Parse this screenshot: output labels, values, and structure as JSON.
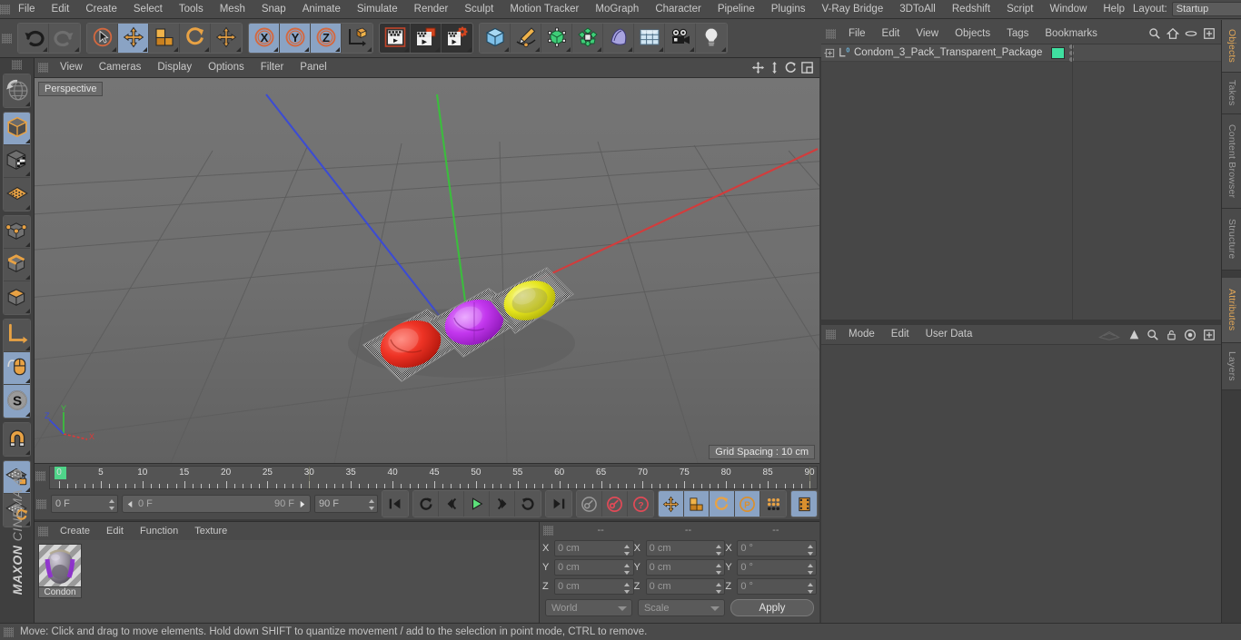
{
  "app": {
    "title": "MAXON CINEMA 4D",
    "brand_top": "MAXON",
    "brand_bottom": "CINEMA 4D"
  },
  "menubar": {
    "items": [
      "File",
      "Edit",
      "Create",
      "Select",
      "Tools",
      "Mesh",
      "Snap",
      "Animate",
      "Simulate",
      "Render",
      "Sculpt",
      "Motion Tracker",
      "MoGraph",
      "Character",
      "Pipeline",
      "Plugins",
      "V-Ray Bridge",
      "3DToAll",
      "Redshift",
      "Script",
      "Window",
      "Help"
    ],
    "layout_label": "Layout:",
    "layout_value": "Startup"
  },
  "toolbar": {
    "groups": [
      {
        "name": "history",
        "buttons": [
          {
            "name": "undo-button",
            "icon": "undo-icon",
            "state": "normal"
          },
          {
            "name": "redo-button",
            "icon": "redo-icon",
            "state": "disabled"
          }
        ]
      },
      {
        "name": "transform-tools",
        "buttons": [
          {
            "name": "live-selection-button",
            "icon": "live-selection-icon",
            "state": "normal"
          },
          {
            "name": "move-tool-button",
            "icon": "move-icon",
            "state": "active"
          },
          {
            "name": "scale-tool-button",
            "icon": "scale-icon",
            "state": "normal"
          },
          {
            "name": "rotate-tool-button",
            "icon": "rotate-icon",
            "state": "normal"
          },
          {
            "name": "move-duplicate-button",
            "icon": "move-icon",
            "state": "normal"
          }
        ]
      },
      {
        "name": "axis-locks",
        "buttons": [
          {
            "name": "lock-x-button",
            "icon": "x-axis-icon",
            "state": "active"
          },
          {
            "name": "lock-y-button",
            "icon": "y-axis-icon",
            "state": "active"
          },
          {
            "name": "lock-z-button",
            "icon": "z-axis-icon",
            "state": "active"
          },
          {
            "name": "world-object-axis-button",
            "icon": "world-axis-icon",
            "state": "normal"
          }
        ]
      },
      {
        "name": "render-tools",
        "buttons": [
          {
            "name": "render-view-button",
            "icon": "render-view-icon",
            "state": "dark"
          },
          {
            "name": "render-to-picture-viewer-button",
            "icon": "render-picture-icon",
            "state": "dark"
          },
          {
            "name": "render-settings-button",
            "icon": "render-settings-icon",
            "state": "dark"
          }
        ]
      },
      {
        "name": "create-objects",
        "buttons": [
          {
            "name": "add-primitive-button",
            "icon": "cube-icon",
            "state": "normal"
          },
          {
            "name": "add-spline-button",
            "icon": "pen-spline-icon",
            "state": "normal"
          },
          {
            "name": "add-generator-button",
            "icon": "generator-icon",
            "state": "normal"
          },
          {
            "name": "add-deformer-button",
            "icon": "deformer-icon",
            "state": "normal"
          },
          {
            "name": "add-scene-object-button",
            "icon": "scene-object-icon",
            "state": "normal"
          },
          {
            "name": "add-environment-button",
            "icon": "environment-icon",
            "state": "normal"
          },
          {
            "name": "add-camera-button",
            "icon": "camera-icon",
            "state": "normal"
          },
          {
            "name": "add-light-button",
            "icon": "light-bulb-icon",
            "state": "normal"
          }
        ]
      }
    ]
  },
  "left_toolbar": {
    "groups": [
      {
        "buttons": [
          {
            "name": "undo-view-button",
            "icon": "globe-undo-icon",
            "state": "normal"
          }
        ]
      },
      {
        "buttons": [
          {
            "name": "model-mode-button",
            "icon": "model-cube-icon",
            "state": "active"
          },
          {
            "name": "texture-mode-button",
            "icon": "texture-cube-icon",
            "state": "normal"
          },
          {
            "name": "workplane-mode-button",
            "icon": "workplane-icon",
            "state": "normal"
          }
        ]
      },
      {
        "buttons": [
          {
            "name": "point-mode-button",
            "icon": "point-cube-icon",
            "state": "normal"
          },
          {
            "name": "edge-mode-button",
            "icon": "edge-cube-icon",
            "state": "normal"
          },
          {
            "name": "polygon-mode-button",
            "icon": "polygon-cube-icon",
            "state": "normal"
          }
        ]
      },
      {
        "buttons": [
          {
            "name": "object-axis-button",
            "icon": "axis-icon",
            "state": "normal"
          },
          {
            "name": "viewport-solo-button",
            "icon": "mouse-icon",
            "state": "active"
          },
          {
            "name": "soft-selection-button",
            "icon": "soft-selection-icon",
            "state": "active"
          }
        ]
      },
      {
        "buttons": [
          {
            "name": "magnet-tool-button",
            "icon": "magnet-icon",
            "state": "normal"
          }
        ]
      },
      {
        "buttons": [
          {
            "name": "lock-workplane-button",
            "icon": "workplane-lock-icon",
            "state": "active"
          },
          {
            "name": "workplane-rotate-button",
            "icon": "workplane-rotate-icon",
            "state": "normal"
          }
        ]
      }
    ]
  },
  "viewport": {
    "menu": [
      "View",
      "Cameras",
      "Display",
      "Options",
      "Filter",
      "Panel"
    ],
    "camera_label": "Perspective",
    "grid_spacing": "Grid Spacing : 10 cm",
    "header_icons": [
      "move-camera-icon",
      "dolly-camera-icon",
      "rotate-camera-icon",
      "maximize-viewport-icon"
    ],
    "axis_gizmo": {
      "x": "X",
      "y": "Y",
      "z": "Z"
    },
    "scene": {
      "objects": [
        {
          "name": "condom-package-red",
          "color": "#e02a1e"
        },
        {
          "name": "condom-package-magenta",
          "color": "#c234e8"
        },
        {
          "name": "condom-package-yellow",
          "color": "#e2e21a"
        }
      ],
      "axis_colors": {
        "x": "#d83a3a",
        "y": "#39c23b",
        "z": "#3a4ad8"
      }
    }
  },
  "timeline": {
    "tick_labels": [
      "0",
      "5",
      "10",
      "15",
      "20",
      "25",
      "30",
      "35",
      "40",
      "45",
      "50",
      "55",
      "60",
      "65",
      "70",
      "75",
      "80",
      "85",
      "90"
    ],
    "current_frame": "0 F",
    "preview_min": "0 F",
    "preview_max": "90 F",
    "end_frame": "90 F",
    "frame_field_right": "0 F",
    "transport": [
      {
        "name": "go-to-start-button",
        "icon": "skip-start-icon",
        "state": "normal"
      },
      {
        "name": "play-backwards-loop-button",
        "icon": "loop-icon",
        "state": "normal"
      },
      {
        "name": "step-back-button",
        "icon": "step-back-icon",
        "state": "normal"
      },
      {
        "name": "play-button",
        "icon": "play-icon",
        "state": "normal"
      },
      {
        "name": "step-forward-button",
        "icon": "step-forward-icon",
        "state": "normal"
      },
      {
        "name": "loop-playback-button",
        "icon": "loop-forward-icon",
        "state": "normal"
      },
      {
        "name": "go-to-end-button",
        "icon": "skip-end-icon",
        "state": "normal"
      }
    ],
    "keyframe_tools": [
      {
        "name": "record-active-objects-button",
        "icon": "key-icon",
        "state": "normal"
      },
      {
        "name": "autokeying-button",
        "icon": "autokey-icon",
        "state": "normal"
      },
      {
        "name": "keyframe-selection-button",
        "icon": "keyframe-question-icon",
        "state": "normal"
      }
    ],
    "position_tools": [
      {
        "name": "record-position-button",
        "icon": "move-icon",
        "state": "active"
      },
      {
        "name": "record-scale-button",
        "icon": "scale-icon",
        "state": "active"
      },
      {
        "name": "record-rotation-button",
        "icon": "rotate-icon",
        "state": "active"
      },
      {
        "name": "record-parameter-button",
        "icon": "parameter-p-icon",
        "state": "active"
      },
      {
        "name": "point-level-animation-button",
        "icon": "pla-dots-icon",
        "state": "normal"
      },
      {
        "name": "timeline-toggle-button",
        "icon": "film-strip-icon",
        "state": "active"
      }
    ]
  },
  "material_manager": {
    "menu": [
      "Create",
      "Edit",
      "Function",
      "Texture"
    ],
    "materials": [
      {
        "name": "Condon",
        "swatch_color": "#a98fbe"
      }
    ]
  },
  "coordinates": {
    "header_cols": [
      "--",
      "--",
      "--"
    ],
    "rows": [
      {
        "axis": "X",
        "position": "0 cm",
        "size": "0 cm",
        "rotation": "0 °"
      },
      {
        "axis": "Y",
        "position": "0 cm",
        "size": "0 cm",
        "rotation": "0 °"
      },
      {
        "axis": "Z",
        "position": "0 cm",
        "size": "0 cm",
        "rotation": "0 °"
      }
    ],
    "coord_system": "World",
    "transform_mode": "Scale",
    "apply_label": "Apply"
  },
  "object_manager": {
    "menu": [
      "File",
      "Edit",
      "View",
      "Objects",
      "Tags",
      "Bookmarks"
    ],
    "header_icons": [
      "search-icon",
      "home-icon",
      "ellipse-icon",
      "expand-icon"
    ],
    "rows": [
      {
        "name": "Condom_3_Pack_Transparent_Package",
        "layer_badge": "0",
        "tag_color": "#3fe0a0"
      }
    ]
  },
  "attributes_manager": {
    "menu": [
      "Mode",
      "Edit",
      "User Data"
    ],
    "header_icons": [
      "interface-icon",
      "cursor-arrow-icon",
      "search-icon",
      "lock-icon",
      "target-icon",
      "expand-icon"
    ]
  },
  "right_tabs": {
    "top": [
      {
        "label": "Objects",
        "active": true
      },
      {
        "label": "Takes",
        "active": false
      },
      {
        "label": "Content Browser",
        "active": false
      },
      {
        "label": "Structure",
        "active": false
      }
    ],
    "bottom": [
      {
        "label": "Attributes",
        "active": true
      },
      {
        "label": "Layers",
        "active": false
      }
    ]
  },
  "statusbar": {
    "text": "Move: Click and drag to move elements. Hold down SHIFT to quantize movement / add to the selection in point mode, CTRL to remove."
  },
  "colors": {
    "accent_orange": "#e0a657",
    "panel_bg": "#4a4a4a",
    "body_bg": "#474747",
    "active_blue": "#8aa3c4",
    "viewport_bg": "#6e6e6e"
  }
}
